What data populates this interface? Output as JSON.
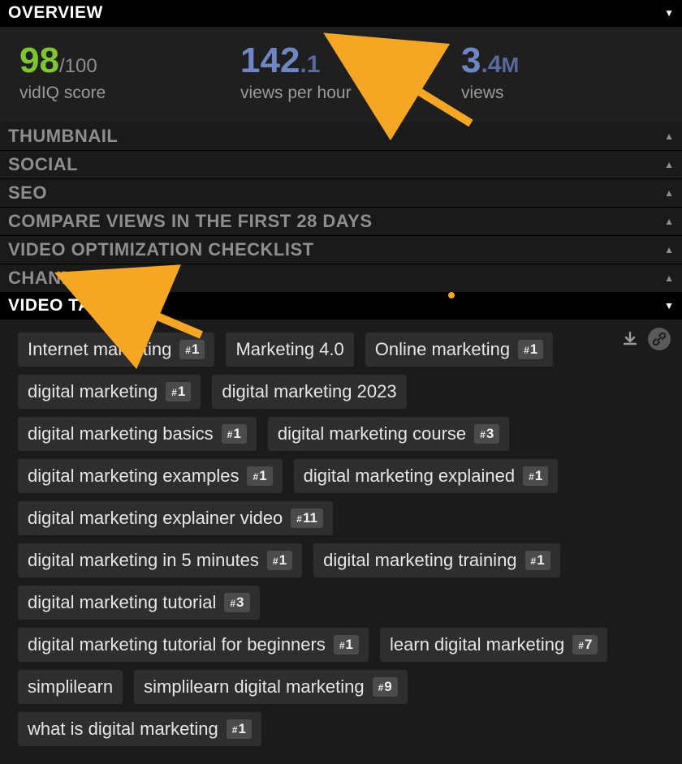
{
  "sections": {
    "overview": "OVERVIEW",
    "thumbnail": "THUMBNAIL",
    "social": "SOCIAL",
    "seo": "SEO",
    "compare": "COMPARE VIEWS IN THE FIRST 28 DAYS",
    "checklist": "VIDEO OPTIMIZATION CHECKLIST",
    "channel": "CHANNEL",
    "videotags": "VIDEO TAGS"
  },
  "overview_stats": {
    "score": {
      "value": "98",
      "out_of": "/100",
      "label": "vidIQ score"
    },
    "vph": {
      "main": "142",
      "sub": ".1",
      "label": "views per hour"
    },
    "views": {
      "main": "3",
      "sub": ".4",
      "unit": "M",
      "label": "views"
    }
  },
  "tags": [
    {
      "text": "Internet marketing",
      "rank": "1"
    },
    {
      "text": "Marketing 4.0",
      "rank": null
    },
    {
      "text": "Online marketing",
      "rank": "1"
    },
    {
      "text": "digital marketing",
      "rank": "1"
    },
    {
      "text": "digital marketing 2023",
      "rank": null
    },
    {
      "text": "digital marketing basics",
      "rank": "1"
    },
    {
      "text": "digital marketing course",
      "rank": "3"
    },
    {
      "text": "digital marketing examples",
      "rank": "1"
    },
    {
      "text": "digital marketing explained",
      "rank": "1"
    },
    {
      "text": "digital marketing explainer video",
      "rank": "11"
    },
    {
      "text": "digital marketing in 5 minutes",
      "rank": "1"
    },
    {
      "text": "digital marketing training",
      "rank": "1"
    },
    {
      "text": "digital marketing tutorial",
      "rank": "3"
    },
    {
      "text": "digital marketing tutorial for beginners",
      "rank": "1"
    },
    {
      "text": "learn digital marketing",
      "rank": "7"
    },
    {
      "text": "simplilearn",
      "rank": null
    },
    {
      "text": "simplilearn digital marketing",
      "rank": "9"
    },
    {
      "text": "what is digital marketing",
      "rank": "1"
    }
  ],
  "icons": {
    "download": "download-icon",
    "link": "link-icon"
  }
}
